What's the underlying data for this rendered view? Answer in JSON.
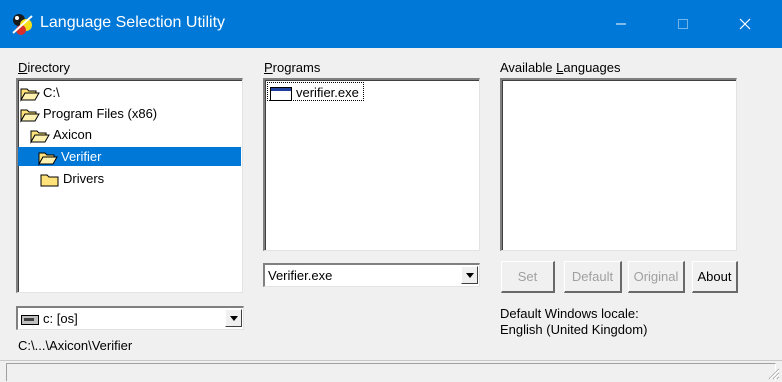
{
  "window": {
    "title": "Language Selection Utility",
    "icons": {
      "app": "app-icon",
      "minimize": "minimize-icon",
      "maximize": "maximize-icon",
      "close": "close-icon"
    }
  },
  "directory": {
    "label_accel": "D",
    "label_rest": "irectory",
    "items": [
      {
        "label": "C:\\",
        "icon": "folder-open-icon",
        "selected": false
      },
      {
        "label": "Program Files (x86)",
        "icon": "folder-open-icon",
        "selected": false
      },
      {
        "label": "Axicon",
        "icon": "folder-open-icon",
        "selected": false
      },
      {
        "label": "Verifier",
        "icon": "folder-open-icon",
        "selected": true
      },
      {
        "label": "Drivers",
        "icon": "folder-closed-icon",
        "selected": false
      }
    ],
    "drive_value": "c: [os]",
    "path": "C:\\...\\Axicon\\Verifier"
  },
  "programs": {
    "label_accel": "P",
    "label_rest": "rograms",
    "items": [
      {
        "label": "verifier.exe",
        "icon": "exe-window-icon"
      }
    ],
    "combo_value": "Verifier.exe"
  },
  "languages": {
    "label_pre": "Available ",
    "label_accel": "L",
    "label_rest": "anguages",
    "buttons": {
      "set": "Set",
      "default": "Default",
      "original": "Original",
      "about": "About"
    },
    "locale_caption": "Default Windows locale:",
    "locale_value": "English (United Kingdom)"
  },
  "colors": {
    "titlebar": "#0078d7",
    "selection": "#0078d7",
    "window_bg": "#f0f0f0",
    "folder": "#ffe37a"
  }
}
